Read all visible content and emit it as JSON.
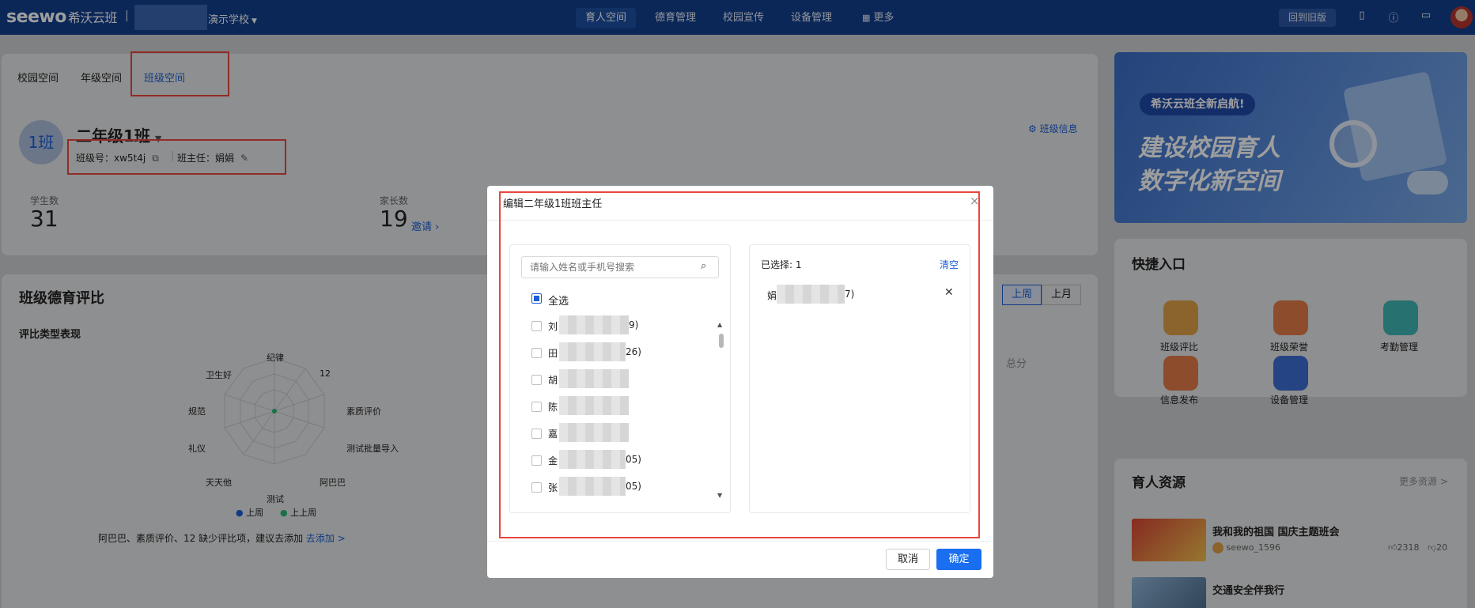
{
  "header": {
    "logo_en": "seewo",
    "logo_cn": "希沃云班",
    "school": "演示学校",
    "nav": [
      "育人空间",
      "德育管理",
      "校园宣传",
      "设备管理",
      "更多"
    ],
    "back_old": "回到旧版"
  },
  "space_tabs": [
    "校园空间",
    "年级空间",
    "班级空间"
  ],
  "class_info": {
    "avatar": "1班",
    "name": "二年级1班",
    "class_no": "班级号：xw5t4j",
    "teacher": "班主任：娟娟",
    "info_link": "班级信息",
    "students_label": "学生数",
    "students": "31",
    "parents_label": "家长数",
    "parents": "19",
    "invite": "邀请"
  },
  "evaluation": {
    "title": "班级德育评比",
    "periods": [
      "上周",
      "上月"
    ],
    "subtitle": "评比类型表现",
    "radar_labels": [
      "纪律",
      "12",
      "素质评价",
      "测试批量导入",
      "阿巴巴",
      "测试",
      "天天他",
      "礼仪",
      "规范",
      "卫生好"
    ],
    "legend": [
      "上周",
      "上上周"
    ],
    "total": "总分",
    "hint": "阿巴巴、素质评价、12 缺少评比项，建议去添加",
    "hint_link": "去添加 >"
  },
  "banner": {
    "badge": "希沃云班全新启航!",
    "line1": "建设校园育人",
    "line2": "数字化新空间"
  },
  "quick": {
    "title": "快捷入口",
    "items": [
      "班级评比",
      "班级荣誉",
      "考勤管理",
      "信息发布",
      "设备管理"
    ]
  },
  "resources": {
    "title": "育人资源",
    "more": "更多资源 >",
    "items": [
      {
        "title": "我和我的祖国 国庆主题班会",
        "author": "seewo_1596",
        "likes": "2318",
        "dislikes": "20"
      },
      {
        "title": "交通安全伴我行",
        "author": "",
        "likes": "",
        "dislikes": ""
      }
    ]
  },
  "modal": {
    "title": "编辑二年级1班班主任",
    "search_placeholder": "请输入姓名或手机号搜索",
    "select_all": "全选",
    "list": [
      {
        "prefix": "刘",
        "suffix": "9)"
      },
      {
        "prefix": "田",
        "suffix": "26)"
      },
      {
        "prefix": "胡",
        "suffix": ""
      },
      {
        "prefix": "陈",
        "suffix": ""
      },
      {
        "prefix": "嘉",
        "suffix": ""
      },
      {
        "prefix": "金",
        "suffix": "05)"
      },
      {
        "prefix": "张",
        "suffix": "05)"
      }
    ],
    "selected_label": "已选择: 1",
    "clear": "清空",
    "selected_item": {
      "prefix": "娟",
      "suffix": "7)"
    },
    "cancel": "取消",
    "confirm": "确定"
  },
  "colors": {
    "brand_blue": "#1a5fd6",
    "header": "#123f8f",
    "highlight_red": "#e8473f"
  }
}
